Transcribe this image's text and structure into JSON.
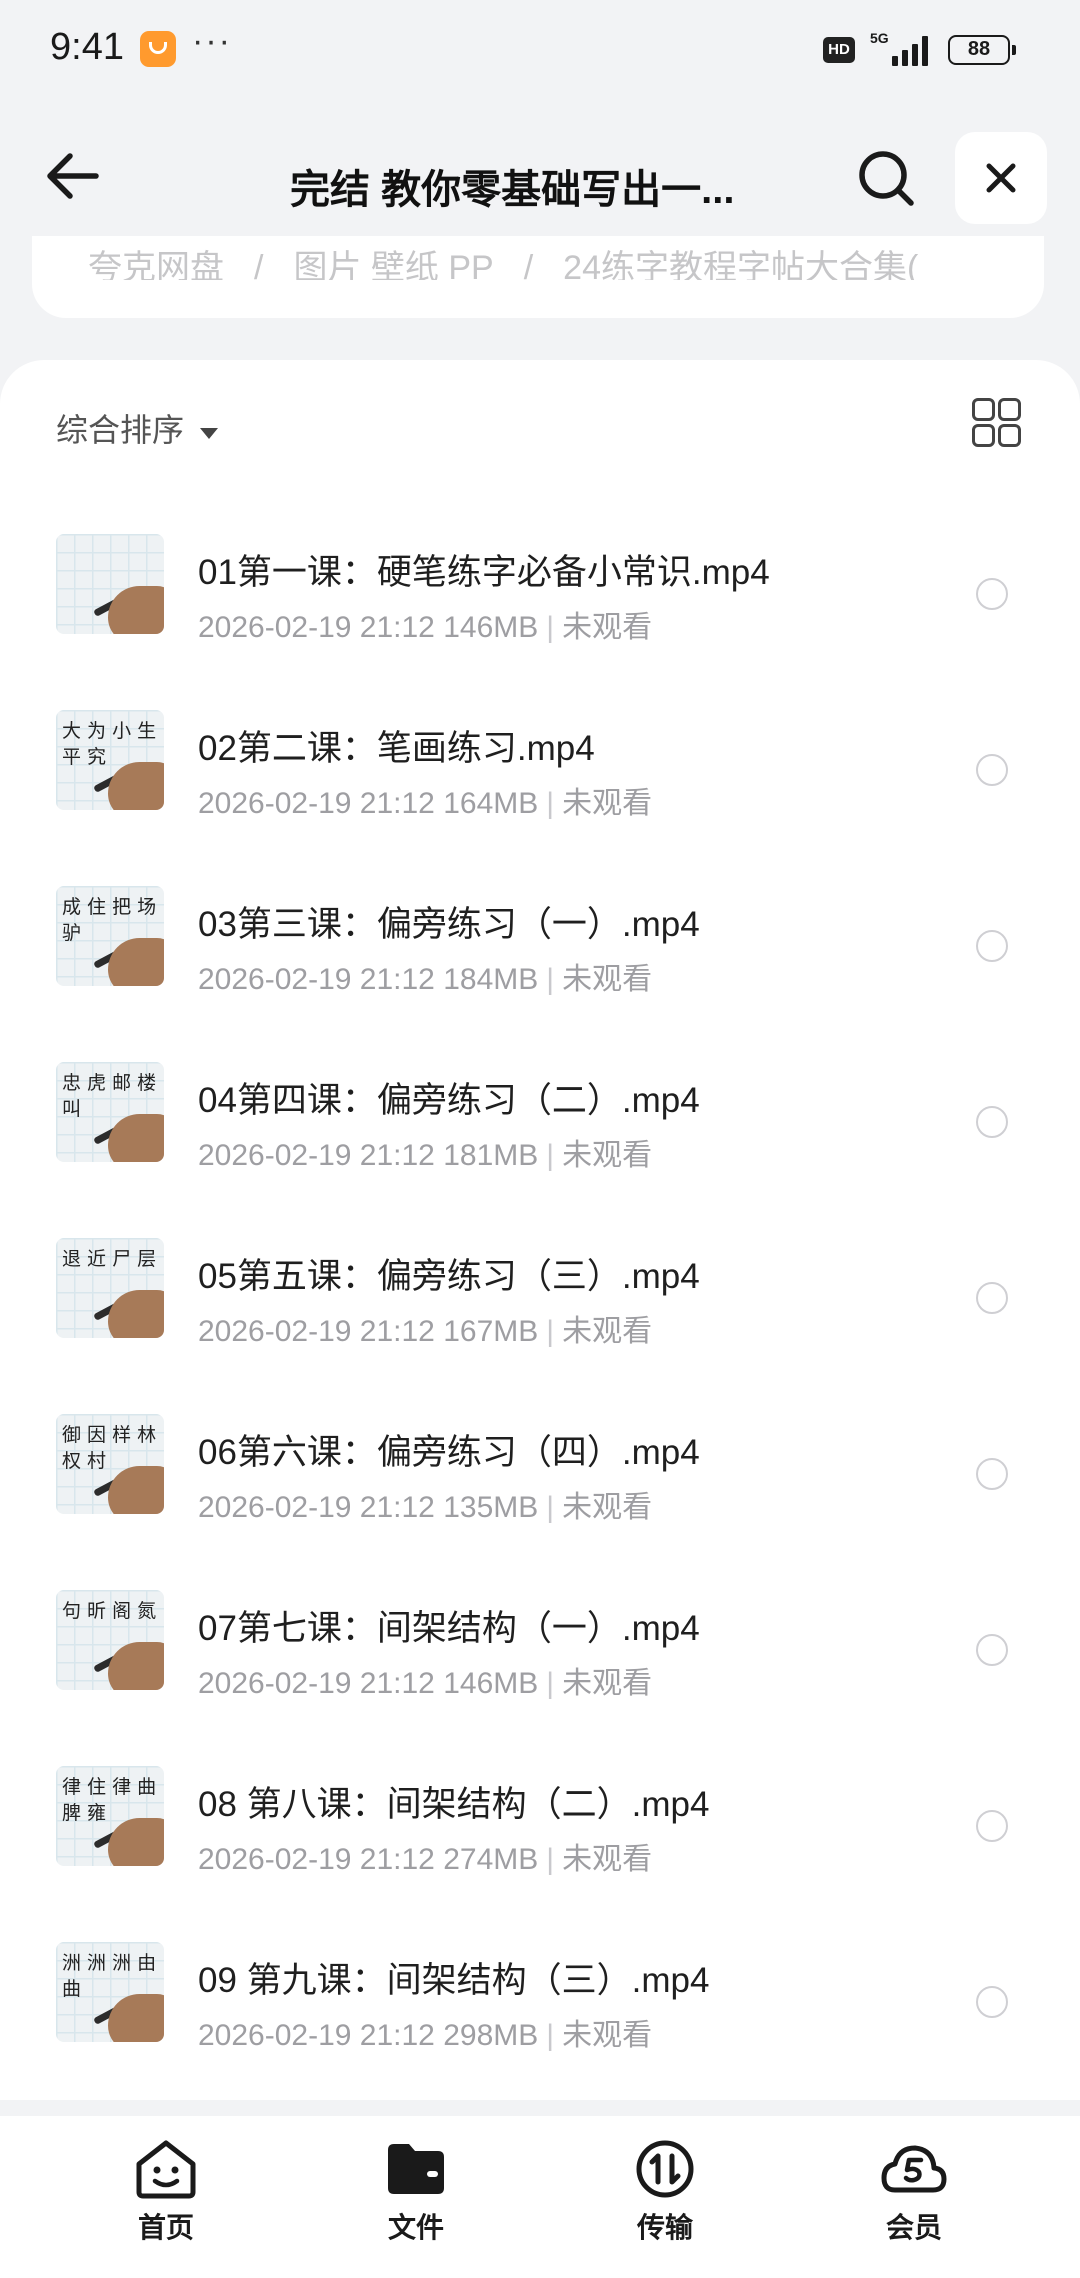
{
  "status_bar": {
    "time": "9:41",
    "overflow": "···",
    "network_badge": "HD",
    "network_type": "5G",
    "battery": "88"
  },
  "nav": {
    "title": "完结 教你零基础写出一..."
  },
  "breadcrumb": {
    "items": [
      "夸克网盘",
      "图片 壁纸 PP",
      "24练字教程字帖大合集("
    ]
  },
  "toolbar": {
    "sort_label": "综合排序"
  },
  "files": [
    {
      "name": "01第一课：硬笔练字必备小常识.mp4",
      "date": "2026-02-19 21:12",
      "size": "146MB",
      "status": "未观看",
      "thumb_text": ""
    },
    {
      "name": "02第二课：笔画练习.mp4",
      "date": "2026-02-19 21:12",
      "size": "164MB",
      "status": "未观看",
      "thumb_text": "大 为 小 生 平 究"
    },
    {
      "name": "03第三课：偏旁练习（一）.mp4",
      "date": "2026-02-19 21:12",
      "size": "184MB",
      "status": "未观看",
      "thumb_text": "成 住 把 场 驴"
    },
    {
      "name": "04第四课：偏旁练习（二）.mp4",
      "date": "2026-02-19 21:12",
      "size": "181MB",
      "status": "未观看",
      "thumb_text": "忠 虎 邮 楼 叫"
    },
    {
      "name": "05第五课：偏旁练习（三）.mp4",
      "date": "2026-02-19 21:12",
      "size": "167MB",
      "status": "未观看",
      "thumb_text": "退 近 尸 层"
    },
    {
      "name": "06第六课：偏旁练习（四）.mp4",
      "date": "2026-02-19 21:12",
      "size": "135MB",
      "status": "未观看",
      "thumb_text": "御 因 样 林 权 村"
    },
    {
      "name": "07第七课：间架结构（一）.mp4",
      "date": "2026-02-19 21:12",
      "size": "146MB",
      "status": "未观看",
      "thumb_text": "句 昕 阁 氮"
    },
    {
      "name": "08 第八课：间架结构（二）.mp4",
      "date": "2026-02-19 21:12",
      "size": "274MB",
      "status": "未观看",
      "thumb_text": "律 住 律 曲 脾 雍"
    },
    {
      "name": "09 第九课：间架结构（三）.mp4",
      "date": "2026-02-19 21:12",
      "size": "298MB",
      "status": "未观看",
      "thumb_text": "洲 洲 洲 由 曲"
    }
  ],
  "tabs": [
    {
      "label": "首页",
      "icon": "home-face-icon"
    },
    {
      "label": "文件",
      "icon": "folder-icon"
    },
    {
      "label": "传输",
      "icon": "transfer-icon"
    },
    {
      "label": "会员",
      "icon": "member-cloud-icon"
    }
  ]
}
